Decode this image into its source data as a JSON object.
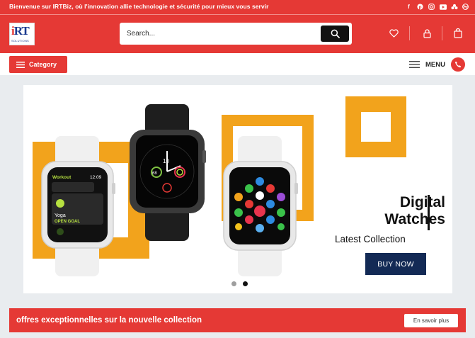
{
  "topbar": {
    "text": "Bienvenue sur IRTBiz, où l'innovation allie technologie et sécurité pour mieux vous servir",
    "social_icons": [
      "facebook-icon",
      "pinterest-icon",
      "instagram-icon",
      "youtube-icon",
      "flickr-icon",
      "dribbble-icon"
    ]
  },
  "header": {
    "logo_main": "iRT",
    "logo_sub": "SOLUTIONS",
    "search_placeholder": "Search...",
    "icons": [
      "heart-icon",
      "lock-icon",
      "shopping-bag-icon"
    ]
  },
  "navbar": {
    "category_label": "Category",
    "menu_label": "MENU"
  },
  "hero": {
    "title_line1": "Digital",
    "title_line2": "Watches",
    "subtitle": "Latest Collection",
    "button_label": "BUY NOW",
    "slide_count": 2,
    "active_slide": 2,
    "watch1": {
      "app": "Workout",
      "time": "12:09",
      "activity": "Yoga",
      "goal": "OPEN GOAL"
    },
    "watch2": {
      "complication": "10",
      "left": "68"
    },
    "accent_color": "#f2a31c"
  },
  "promo": {
    "text": "offres exceptionnelles sur la nouvelle collection",
    "button_label": "En savoir plus"
  },
  "colors": {
    "brand_red": "#e53935",
    "navy": "#132a55",
    "orange": "#f2a31c"
  }
}
